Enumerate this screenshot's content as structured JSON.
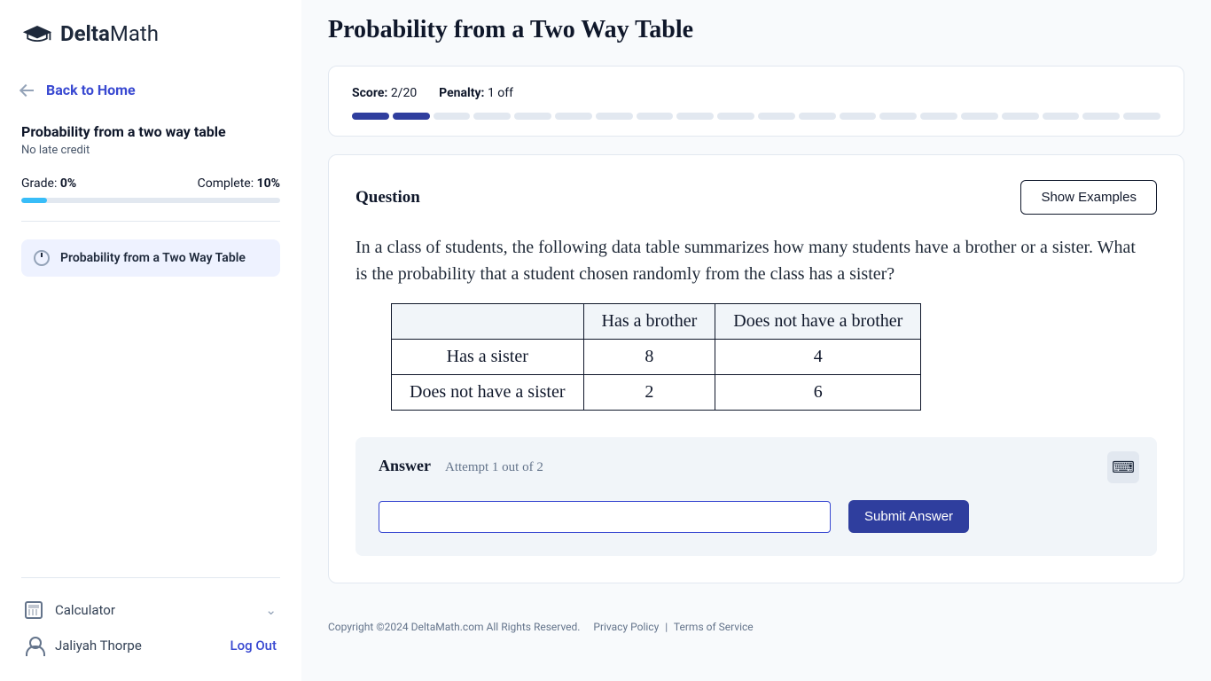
{
  "brand": {
    "name_bold": "Delta",
    "name_light": "Math"
  },
  "sidebar": {
    "back_label": "Back to Home",
    "assignment_title": "Probability from a two way table",
    "assignment_sub": "No late credit",
    "grade_label": "Grade:",
    "grade_value": "0%",
    "complete_label": "Complete:",
    "complete_value": "10%",
    "progress_pct": 10,
    "skill_label": "Probability from a Two Way Table",
    "calculator_label": "Calculator",
    "user_name": "Jaliyah Thorpe",
    "logout_label": "Log Out"
  },
  "main": {
    "page_title": "Probability from a Two Way Table",
    "score_label": "Score:",
    "score_value": "2/20",
    "penalty_label": "Penalty:",
    "penalty_value": "1 off",
    "segments_total": 20,
    "segments_done": 2,
    "question_heading": "Question",
    "show_examples_label": "Show Examples",
    "question_text": "In a class of students, the following data table summarizes how many students have a brother or a sister. What is the probability that a student chosen randomly from the class has a sister?",
    "table": {
      "col_headers": [
        "",
        "Has a brother",
        "Does not have a brother"
      ],
      "rows": [
        {
          "label": "Has a sister",
          "c1": "8",
          "c2": "4"
        },
        {
          "label": "Does not have a sister",
          "c1": "2",
          "c2": "6"
        }
      ]
    },
    "answer_heading": "Answer",
    "attempt_text": "Attempt 1 out of 2",
    "answer_value": "",
    "submit_label": "Submit Answer"
  },
  "footer": {
    "copyright": "Copyright ©2024 DeltaMath.com All Rights Reserved.",
    "privacy": "Privacy Policy",
    "terms": "Terms of Service"
  }
}
